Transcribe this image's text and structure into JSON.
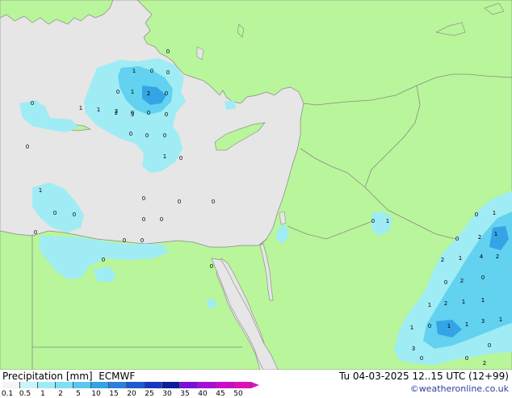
{
  "map": {
    "colors": {
      "sea": "#e6e6e6",
      "land": "#b9f59a",
      "precip_light": "#a0ecf4",
      "precip_mid": "#62d2f0",
      "precip_heavy": "#34a4e6",
      "border": "#8a8a8a",
      "coast": "#909090"
    },
    "precip_labels": [
      {
        "t": "0"
      },
      {
        "t": "0"
      },
      {
        "t": "1"
      },
      {
        "t": "0"
      },
      {
        "t": "0"
      },
      {
        "t": "1"
      },
      {
        "t": "2"
      },
      {
        "t": "0"
      },
      {
        "t": "1"
      },
      {
        "t": "1"
      },
      {
        "t": "2"
      },
      {
        "t": "0"
      },
      {
        "t": "0"
      },
      {
        "t": "0"
      },
      {
        "t": "0"
      },
      {
        "t": "2"
      },
      {
        "t": "3"
      },
      {
        "t": "0"
      },
      {
        "t": "0"
      },
      {
        "t": "0"
      },
      {
        "t": "1"
      },
      {
        "t": "0"
      },
      {
        "t": "0"
      },
      {
        "t": "1"
      },
      {
        "t": "0"
      },
      {
        "t": "0"
      },
      {
        "t": "0"
      },
      {
        "t": "0"
      },
      {
        "t": "0"
      },
      {
        "t": "0"
      },
      {
        "t": "0"
      },
      {
        "t": "0"
      },
      {
        "t": "0"
      },
      {
        "t": "0"
      },
      {
        "t": "0"
      },
      {
        "t": "0"
      },
      {
        "t": "1"
      },
      {
        "t": "0"
      },
      {
        "t": "0"
      },
      {
        "t": "1"
      },
      {
        "t": "0"
      },
      {
        "t": "2"
      },
      {
        "t": "1"
      },
      {
        "t": "4"
      },
      {
        "t": "2"
      },
      {
        "t": "2"
      },
      {
        "t": "1"
      },
      {
        "t": "0"
      },
      {
        "t": "2"
      },
      {
        "t": "0"
      },
      {
        "t": "1"
      },
      {
        "t": "2"
      },
      {
        "t": "1"
      },
      {
        "t": "1"
      },
      {
        "t": "1"
      },
      {
        "t": "0"
      },
      {
        "t": "1"
      },
      {
        "t": "1"
      },
      {
        "t": "3"
      },
      {
        "t": "1"
      },
      {
        "t": "3"
      },
      {
        "t": "0"
      },
      {
        "t": "0"
      },
      {
        "t": "2"
      },
      {
        "t": "0"
      }
    ]
  },
  "footer": {
    "title": "Precipitation [mm]  ECMWF",
    "datetime": "Tu 04-03-2025 12..15 UTC (12+99)",
    "credit": "©weatheronline.co.uk"
  },
  "legend": {
    "ticks": [
      "0.1",
      "0.5",
      "1",
      "2",
      "5",
      "10",
      "15",
      "20",
      "25",
      "30",
      "35",
      "40",
      "45",
      "50"
    ],
    "colors": [
      "#f5f5f5",
      "#c8f4fa",
      "#a0ecf4",
      "#7ee0f2",
      "#5ac8ee",
      "#34a4e6",
      "#2a80dc",
      "#1e5ad0",
      "#1638c0",
      "#0c1e9c",
      "#7a10d8",
      "#a80cd8",
      "#cc08cc",
      "#e010b8"
    ]
  }
}
